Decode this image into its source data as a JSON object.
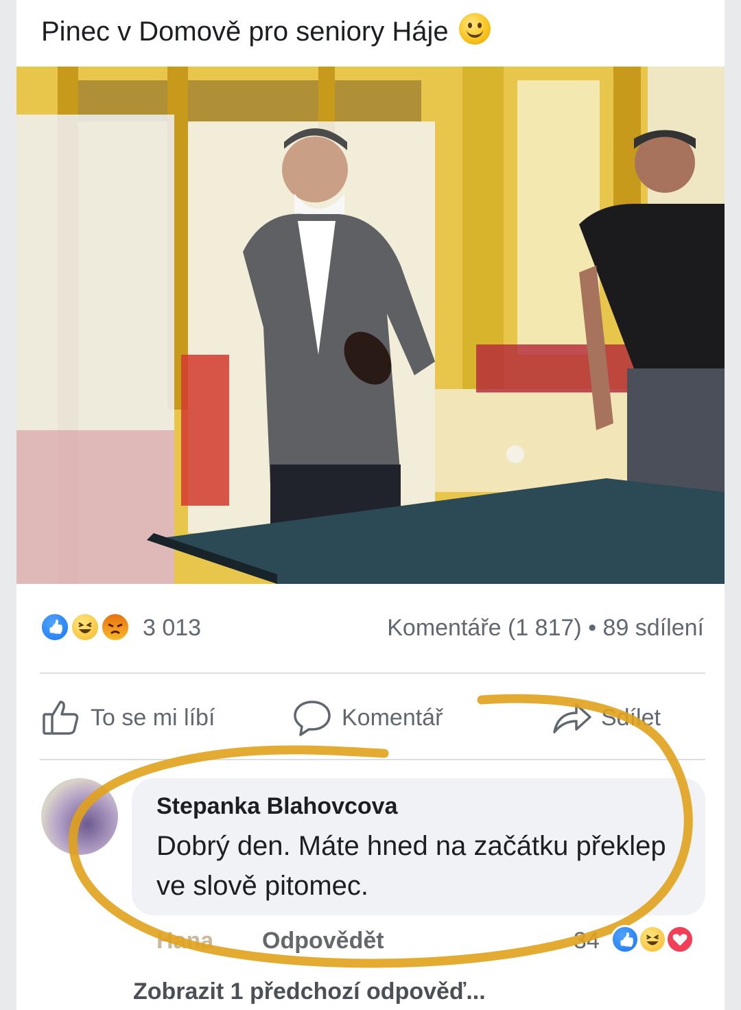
{
  "post": {
    "title": "Pinec v Domově pro seniory Háje",
    "title_emoji": "smiley-icon",
    "photo_description_alt": "photo"
  },
  "reactions": {
    "icons": [
      "like-reaction-icon",
      "haha-reaction-icon",
      "angry-reaction-icon"
    ],
    "count": "3 013",
    "comments_label": "Komentáře (1 817)",
    "separator": "•",
    "shares_label": "89 sdílení"
  },
  "actions": {
    "like": "To se mi líbí",
    "comment": "Komentář",
    "share": "Sdílet"
  },
  "comment": {
    "author": "Stepanka Blahovcova",
    "text": "Dobrý den. Máte hned na začátku překlep ve slově pitomec.",
    "hide_label": "Hana",
    "reply_label": "Odpovědět",
    "reaction_count": "34",
    "reaction_icons": [
      "like-reaction-icon",
      "haha-reaction-icon",
      "love-reaction-icon"
    ]
  },
  "view_previous": "Zobrazit 1 předchozí odpověď...",
  "colors": {
    "highlight_ring": "#e0a21b",
    "facebook_blue": "#1877f2",
    "text_gray": "#606770"
  }
}
